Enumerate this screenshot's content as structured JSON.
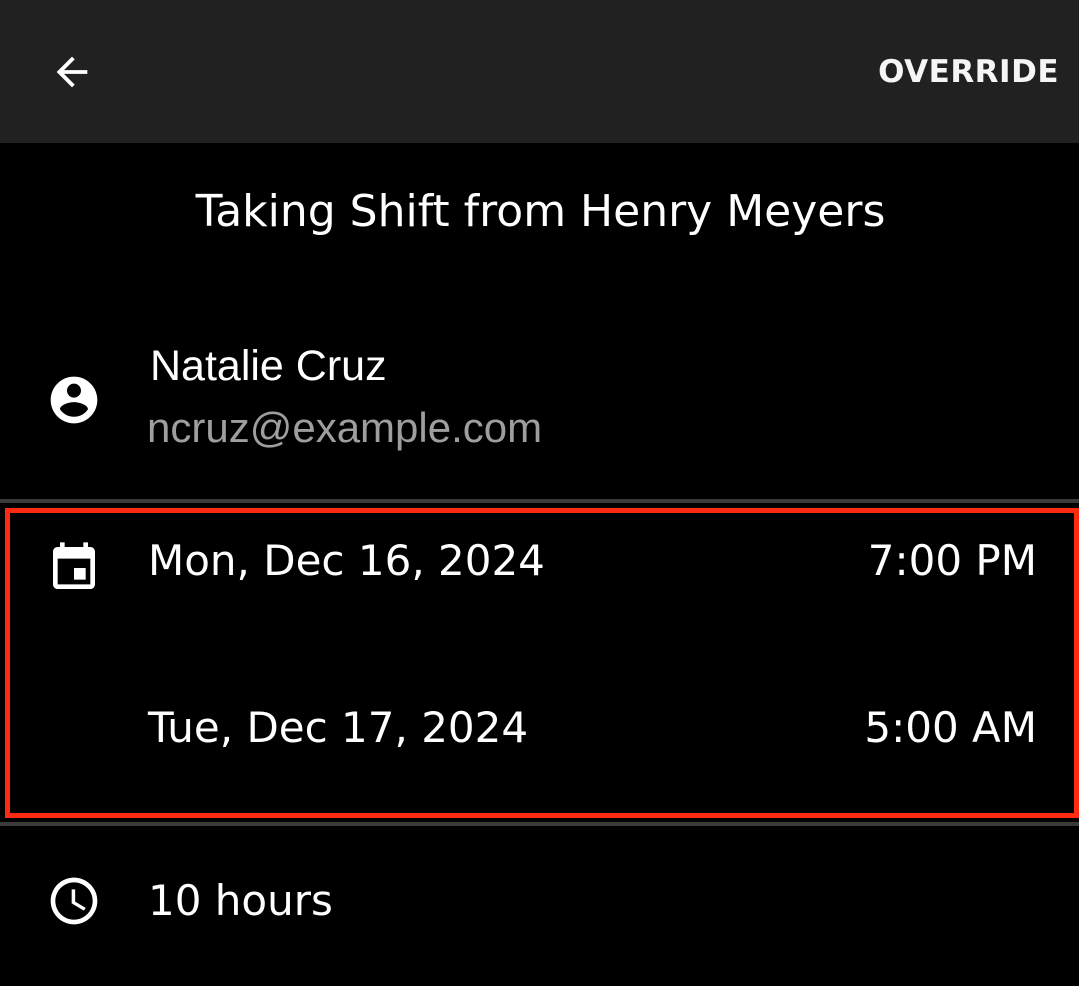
{
  "header": {
    "back_icon": "arrow-back-icon",
    "action_label": "OVERRIDE"
  },
  "title": "Taking Shift from Henry Meyers",
  "user": {
    "icon": "account-circle-icon",
    "name": "Natalie Cruz",
    "email": "ncruz@example.com"
  },
  "shift": {
    "icon": "calendar-icon",
    "start_date": "Mon, Dec 16, 2024",
    "start_time": "7:00 PM",
    "end_date": "Tue, Dec 17, 2024",
    "end_time": "5:00 AM",
    "highlight_color": "#ff2a12"
  },
  "duration": {
    "icon": "clock-icon",
    "label": "10 hours"
  },
  "colors": {
    "appbar_bg": "#212121",
    "background": "#000000",
    "email_text": "#9e9e9e"
  }
}
